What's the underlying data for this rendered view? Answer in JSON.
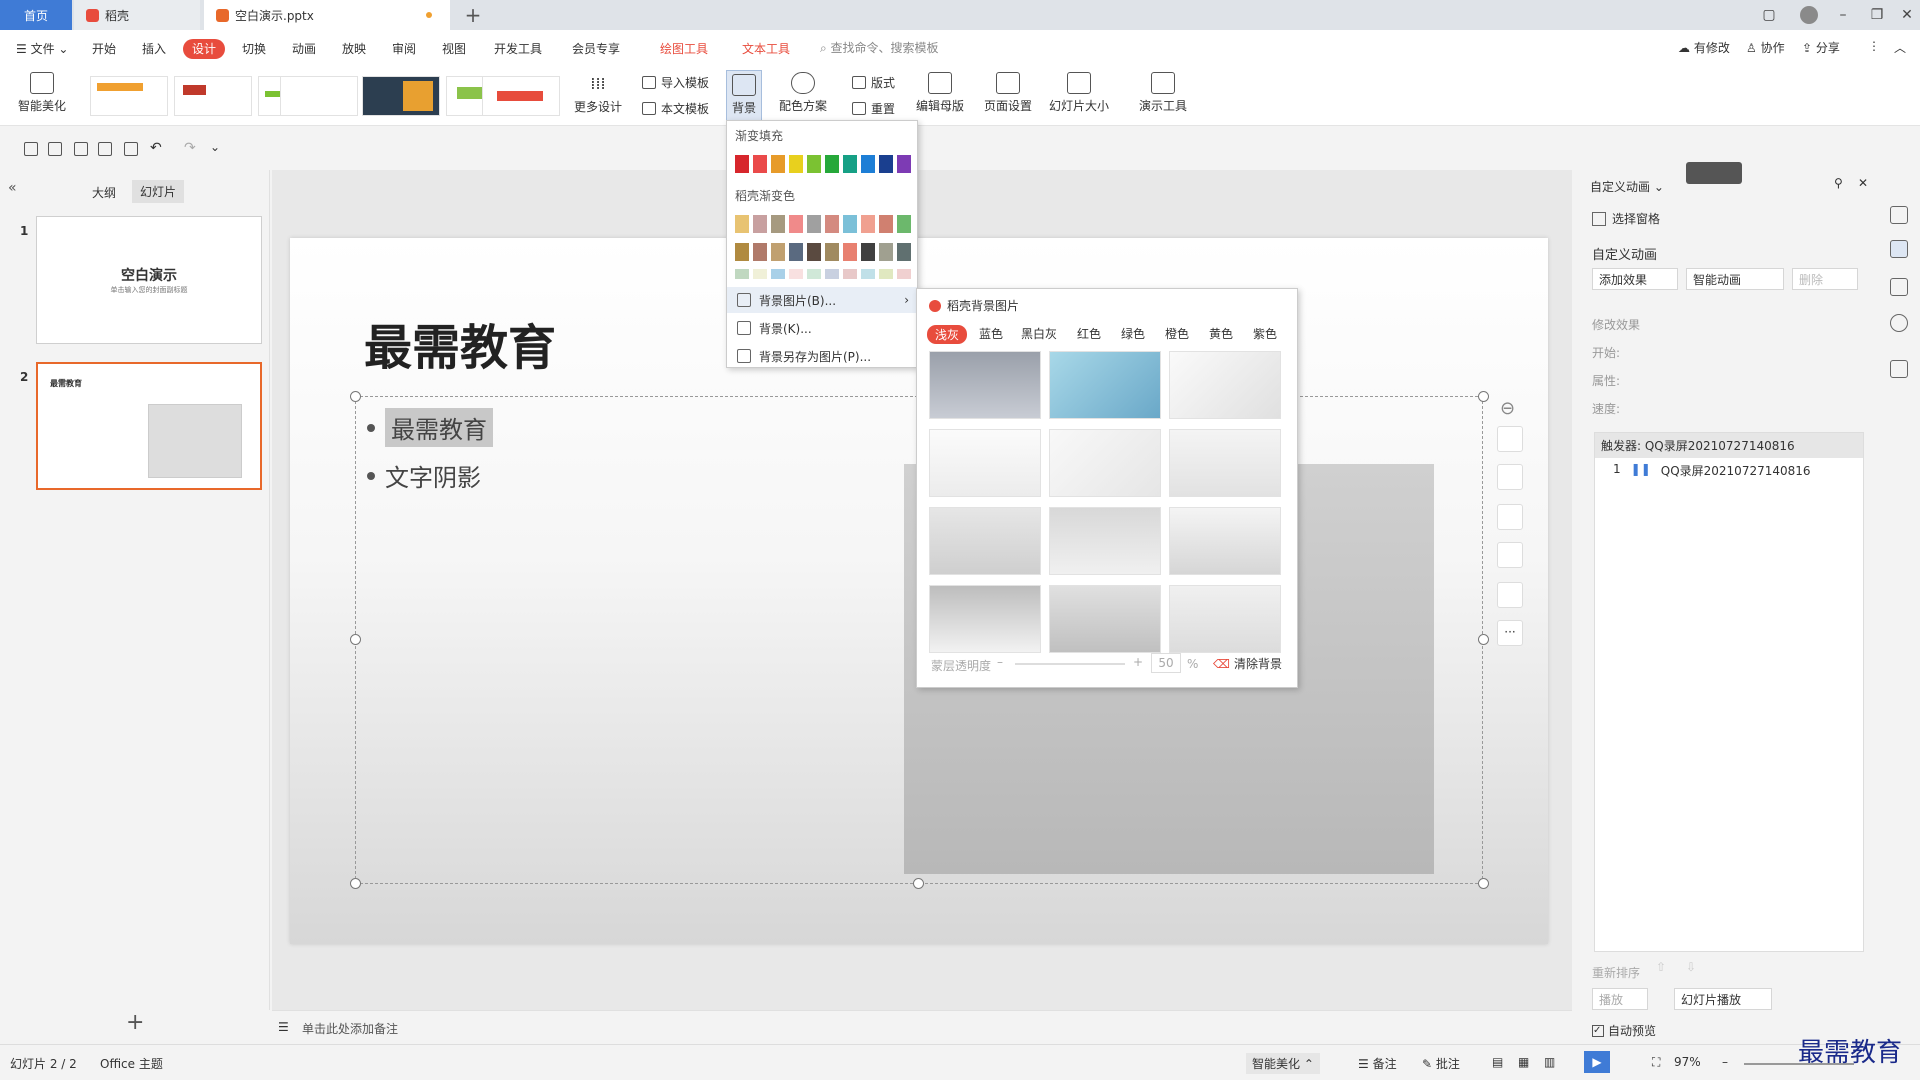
{
  "tabs": {
    "home": "首页",
    "docer": "稻壳",
    "file": "空白演示.pptx"
  },
  "menu": {
    "items": [
      "文件",
      "开始",
      "插入",
      "设计",
      "切换",
      "动画",
      "放映",
      "审阅",
      "视图",
      "开发工具",
      "会员专享",
      "绘图工具",
      "文本工具"
    ],
    "search_placeholder": "查找命令、搜索模板",
    "right": [
      "有修改",
      "协作",
      "分享"
    ]
  },
  "ribbon": {
    "smart_beautify": "智能美化",
    "more_design": "更多设计",
    "import_template": "导入模板",
    "this_template": "本文模板",
    "background": "背景",
    "color_scheme": "配色方案",
    "layout": "版式",
    "reset": "重置",
    "edit_master": "编辑母版",
    "page_setup": "页面设置",
    "slide_size": "幻灯片大小",
    "presenter_tools": "演示工具"
  },
  "left_panel": {
    "tab_outline": "大纲",
    "tab_slides": "幻灯片",
    "slides": [
      {
        "num": "1",
        "title": "空白演示",
        "subtitle": "单击输入您的封面副标题"
      },
      {
        "num": "2",
        "title": "最需教育"
      }
    ]
  },
  "slide": {
    "title": "最需教育",
    "bullets": [
      "最需教育",
      "文字阴影"
    ]
  },
  "bg_menu": {
    "gradient_fill": "渐变填充",
    "docer_gradient": "稻壳渐变色",
    "bg_image": "背景图片(B)...",
    "background": "背景(K)...",
    "save_bg": "背景另存为图片(P)...",
    "gradient_colors": [
      "#d7262c",
      "#ea4a4a",
      "#e79b2a",
      "#e8d01e",
      "#7bc232",
      "#26a83a",
      "#16a085",
      "#1d7ed6",
      "#1a3f8f",
      "#7d3bb4"
    ],
    "docer_rows": [
      [
        "#e8c372",
        "#c8a0a0",
        "#a69a80",
        "#f08a8a",
        "#a0a0a0",
        "#d48a80",
        "#7bc0d8",
        "#f0a090",
        "#d08070",
        "#6cb86c"
      ],
      [
        "#b08a40",
        "#b07a6a",
        "#c0a070",
        "#5a6a80",
        "#5a4a40",
        "#a08a60",
        "#e88070",
        "#404040",
        "#a0a090",
        "#607070"
      ],
      [
        "#c0d8c0",
        "#f0f0d8",
        "#a8d0e8",
        "#f8e0e0",
        "#d0e8d8",
        "#c8d0e0",
        "#e8c8c8",
        "#c0e0e8",
        "#e0e8c0",
        "#f0d0d0"
      ]
    ]
  },
  "bg_pic": {
    "title": "稻壳背景图片",
    "colors": [
      "浅灰",
      "蓝色",
      "黑白灰",
      "红色",
      "绿色",
      "橙色",
      "黄色",
      "紫色"
    ],
    "opacity_label": "蒙层透明度",
    "opacity_value": "50",
    "percent": "%",
    "clear": "清除背景"
  },
  "right_panel": {
    "title": "自定义动画",
    "select_pane": "选择窗格",
    "section": "自定义动画",
    "add_effect": "添加效果",
    "smart_anim": "智能动画",
    "delete": "删除",
    "modify": "修改效果",
    "start": "开始:",
    "prop": "属性:",
    "speed": "速度:",
    "trigger": "触发器: QQ录屏20210727140816",
    "item_num": "1",
    "item_name": "QQ录屏20210727140816",
    "reorder": "重新排序",
    "play": "播放",
    "slide_play": "幻灯片播放",
    "auto_preview": "自动预览"
  },
  "notes": "单击此处添加备注",
  "status": {
    "slide": "幻灯片 2 / 2",
    "theme": "Office 主题",
    "smart": "智能美化",
    "notes": "备注",
    "comment": "批注",
    "zoom": "97%"
  },
  "watermark": "最需教育"
}
